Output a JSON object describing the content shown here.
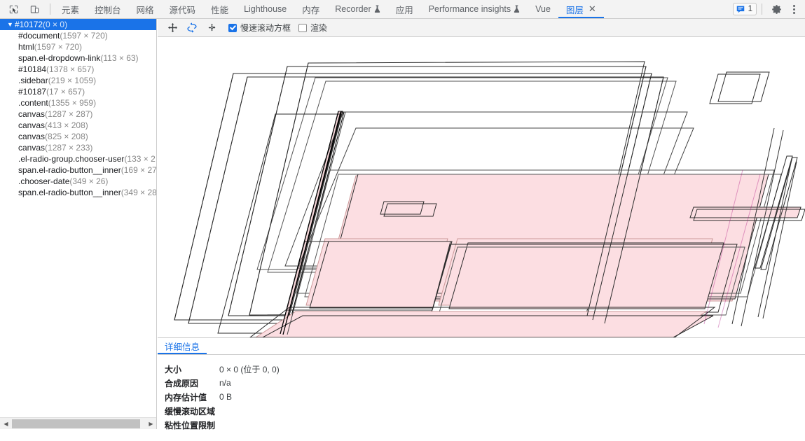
{
  "toolbar": {
    "inspect_icon": "inspect-cursor-icon",
    "device_icon": "device-toolbar-icon",
    "tabs": [
      {
        "label": "元素",
        "flask": false,
        "active": false
      },
      {
        "label": "控制台",
        "flask": false,
        "active": false
      },
      {
        "label": "网络",
        "flask": false,
        "active": false
      },
      {
        "label": "源代码",
        "flask": false,
        "active": false
      },
      {
        "label": "性能",
        "flask": false,
        "active": false
      },
      {
        "label": "Lighthouse",
        "flask": false,
        "active": false
      },
      {
        "label": "内存",
        "flask": false,
        "active": false
      },
      {
        "label": "Recorder",
        "flask": true,
        "active": false
      },
      {
        "label": "应用",
        "flask": false,
        "active": false
      },
      {
        "label": "Performance insights",
        "flask": true,
        "active": false
      },
      {
        "label": "Vue",
        "flask": false,
        "active": false
      },
      {
        "label": "图层",
        "flask": false,
        "active": true,
        "closable": true
      }
    ],
    "tab_close_glyph": "✕",
    "message_count": "1",
    "message_icon": "console-message-icon",
    "settings_icon": "gear-icon",
    "more_icon": "kebab-menu-icon",
    "accent_color": "#1a73e8"
  },
  "tree": {
    "root": {
      "arrow": "▼",
      "name": "#10172",
      "size": "(0 × 0)",
      "selected": true
    },
    "items": [
      {
        "name": "#document",
        "size": "(1597 × 720)"
      },
      {
        "name": "html",
        "size": "(1597 × 720)"
      },
      {
        "name": "span.el-dropdown-link",
        "size": "(113 × 63)"
      },
      {
        "name": "#10184",
        "size": "(1378 × 657)"
      },
      {
        "name": ".sidebar",
        "size": "(219 × 1059)"
      },
      {
        "name": "#10187",
        "size": "(17 × 657)"
      },
      {
        "name": ".content",
        "size": "(1355 × 959)"
      },
      {
        "name": "canvas",
        "size": "(1287 × 287)"
      },
      {
        "name": "canvas",
        "size": "(413 × 208)"
      },
      {
        "name": "canvas",
        "size": "(825 × 208)"
      },
      {
        "name": "canvas",
        "size": "(1287 × 233)"
      },
      {
        "name": ".el-radio-group.chooser-user",
        "size": "(133 × 2"
      },
      {
        "name": "span.el-radio-button__inner",
        "size": "(169 × 27"
      },
      {
        "name": ".chooser-date",
        "size": "(349 × 26)"
      },
      {
        "name": "span.el-radio-button__inner",
        "size": "(349 × 28"
      }
    ],
    "scrollbar": {
      "left_arrow": "◀",
      "right_arrow": "▶"
    }
  },
  "layers_toolbar": {
    "pan_icon": "pan-mode-icon",
    "rotate_icon": "rotate-mode-icon",
    "reset_icon": "reset-transform-icon",
    "slow_scroll_label": "慢速滚动方框",
    "slow_scroll_checked": true,
    "paints_label": "渲染",
    "paints_checked": false
  },
  "details": {
    "tab_label": "详细信息",
    "rows": [
      {
        "label": "大小",
        "value": "0 × 0  (位于 0, 0)"
      },
      {
        "label": "合成原因",
        "value": "n/a"
      },
      {
        "label": "内存估计值",
        "value": "0 B"
      },
      {
        "label": "缓慢滚动区域",
        "value": ""
      },
      {
        "label": "粘性位置限制",
        "value": ""
      }
    ]
  },
  "viewport": {
    "layer_fill": "#fcdee2",
    "layer_stroke": "#2b2b2b",
    "background": "#ffffff"
  }
}
